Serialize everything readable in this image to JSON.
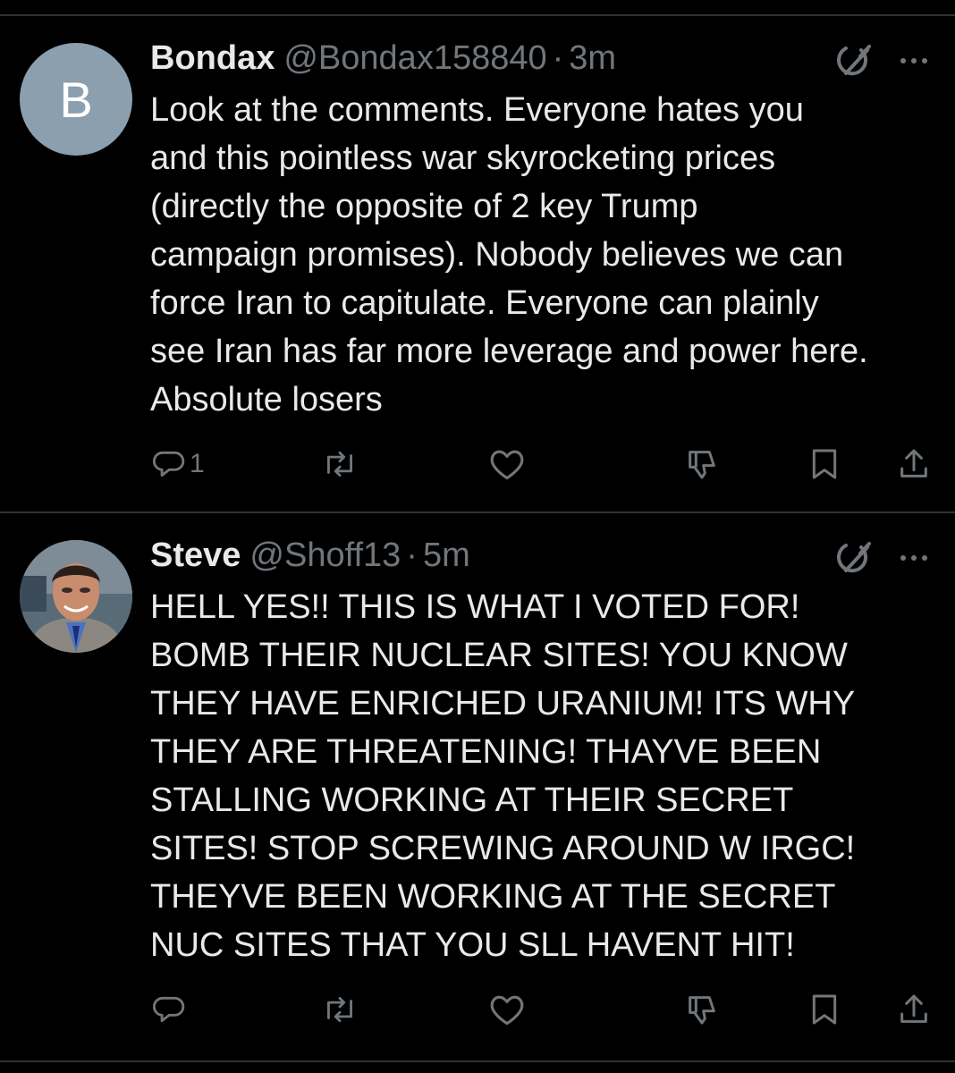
{
  "posts": [
    {
      "avatar_letter": "B",
      "name": "Bondax",
      "handle": "@Bondax158840",
      "separator": "·",
      "time": "3m",
      "lines": [
        "Look at the comments. Everyone hates you",
        "and this pointless war skyrocketing prices",
        "(directly the opposite of 2 key Trump",
        "campaign promises). Nobody believes we can",
        "force Iran to capitulate. Everyone can plainly",
        "see Iran has far more leverage and power here.",
        "Absolute losers"
      ],
      "reply_count": "1"
    },
    {
      "name": "Steve",
      "handle": "@Shoff13",
      "separator": "·",
      "time": "5m",
      "lines": [
        "HELL YES!! THIS IS WHAT I VOTED FOR!",
        "BOMB THEIR NUCLEAR SITES! YOU KNOW",
        "THEY HAVE ENRICHED URANIUM! ITS WHY",
        "THEY ARE THREATENING! THAYVE BEEN",
        "STALLING WORKING AT THEIR SECRET",
        "SITES! STOP SCREWING AROUND W IRGC!",
        "THEYVE BEEN WORKING AT THE SECRET",
        "NUC SITES THAT YOU SLL HAVENT HIT!"
      ],
      "reply_count": ""
    }
  ],
  "icons": {
    "grok": "grok-icon",
    "more": "more-icon",
    "reply": "reply-icon",
    "repost": "repost-icon",
    "like": "heart-icon",
    "dislike": "thumbs-down-icon",
    "bookmark": "bookmark-icon",
    "share": "share-icon"
  },
  "colors": {
    "background": "#000000",
    "text": "#e7e9ea",
    "muted": "#71767b",
    "divider": "#2f3336",
    "avatar_bg": "#8c9fae"
  }
}
